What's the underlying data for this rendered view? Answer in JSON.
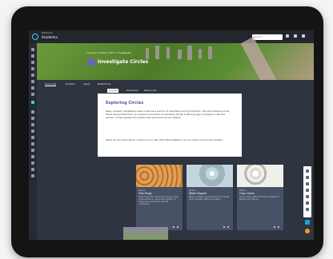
{
  "app": {
    "brand_small": "Delicious",
    "brand": "Academia"
  },
  "topbar": {
    "search_placeholder": "Search..."
  },
  "course": {
    "breadcrumb": "Course / Circles / Unit 5 / Investigate",
    "title": "Investigate Circles"
  },
  "tabs": [
    "Overview",
    "Problem",
    "Apply",
    "Reflections"
  ],
  "subtabs": [
    "Course",
    "Examples",
    "Resources"
  ],
  "content": {
    "heading": "Exploring Circles",
    "para1": "Many ancient civilizations saw circles as a source of inspiration and symbolism. The sand blows across these stones that form an ancient monument of standing stones built long ago in England. Like the stones, circles appear throughout the world and across history.",
    "para2": "What do you think about circles in your own life? What patterns do you notice around you today?"
  },
  "tiles": [
    {
      "label": "Unit 1",
      "name": "Tree Rings",
      "desc": "Tree rings, the concentric rings in tree cross sections, record the growth of trees over years and climate conditions.",
      "colors": [
        "#e0a056",
        "#d28a3a",
        "#bb6d25"
      ]
    },
    {
      "label": "Unit 2",
      "name": "Water Ripples",
      "desc": "Rings of water spreading from a single drop of water hitting a surface.",
      "colors": [
        "#dbe8ee",
        "#c3d6dd",
        "#9fb4bd"
      ]
    },
    {
      "label": "Unit 3",
      "name": "Crop Circles",
      "desc": "Crop circles patterns made in fields of plants from above.",
      "colors": [
        "#f0f0ea",
        "#d8d8d0",
        "#b6b6ad"
      ]
    }
  ]
}
